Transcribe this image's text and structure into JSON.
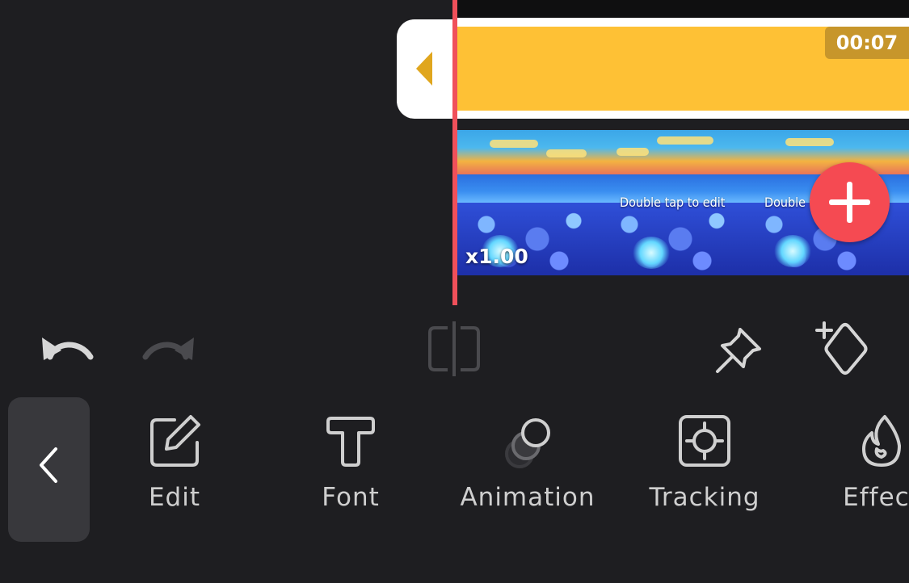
{
  "timeline": {
    "text_clip_duration": "00:07",
    "speed": "x1.00",
    "frame_captions": [
      "Double tap to edit",
      "Double tap to edit"
    ]
  },
  "toolbar": {
    "undo": "undo-icon",
    "redo": "redo-icon",
    "split": "split-icon",
    "pin": "pin-icon",
    "keyframe": "add-keyframe-icon"
  },
  "menu": {
    "back_icon": "chevron-left-icon",
    "items": [
      {
        "label": "Edit",
        "icon": "edit-icon"
      },
      {
        "label": "Font",
        "icon": "font-icon"
      },
      {
        "label": "Animation",
        "icon": "animation-icon"
      },
      {
        "label": "Tracking",
        "icon": "tracking-icon"
      },
      {
        "label": "Effect",
        "icon": "effect-icon"
      }
    ]
  },
  "colors": {
    "background": "#1e1e21",
    "text_clip": "#fec135",
    "playhead": "#f0505a",
    "add_button": "#f54a52"
  }
}
